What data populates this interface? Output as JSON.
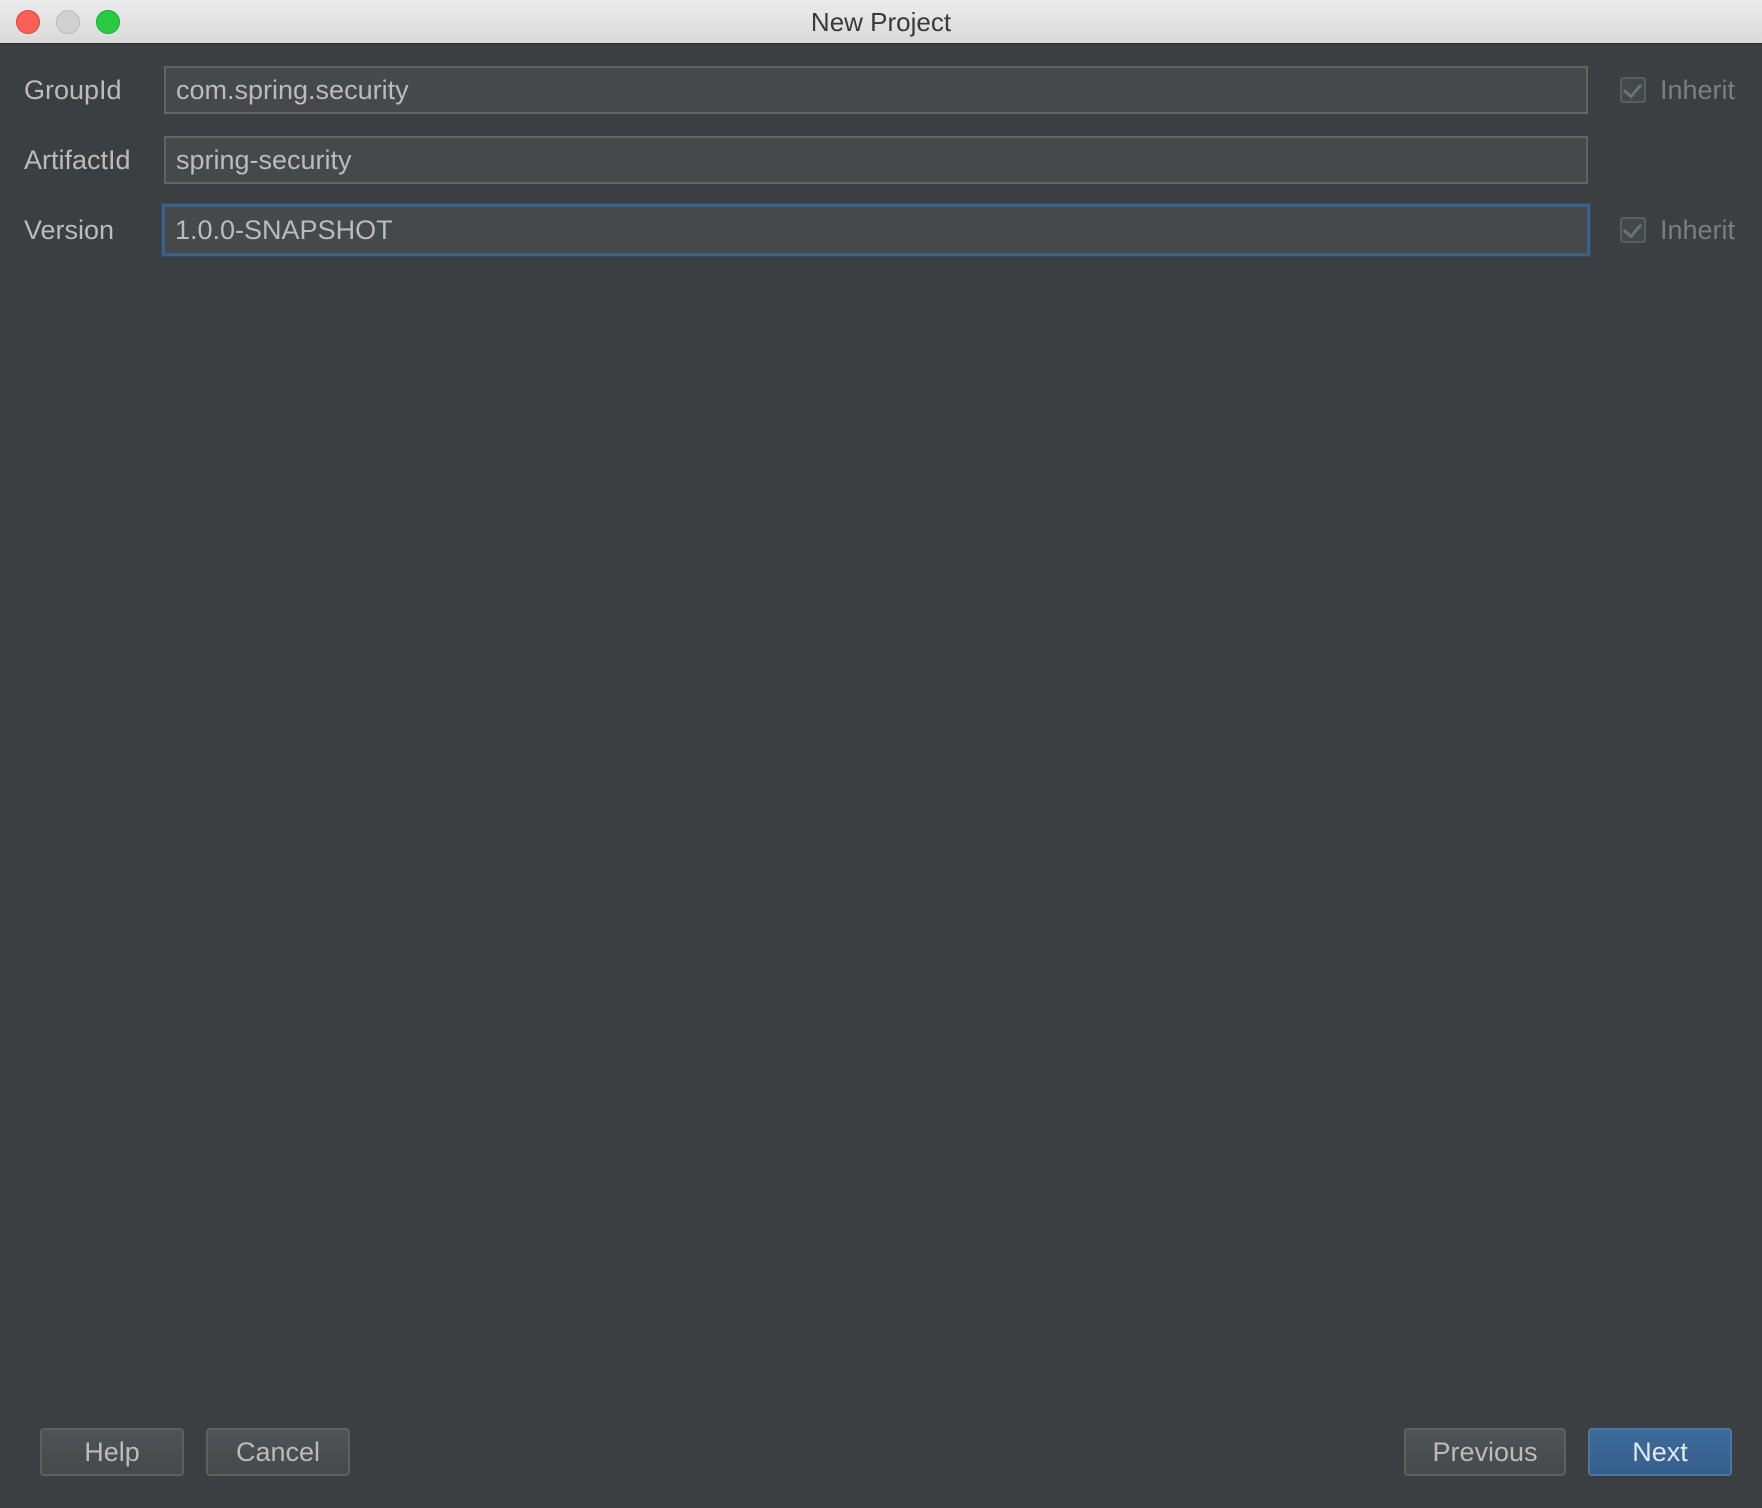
{
  "window": {
    "title": "New Project"
  },
  "form": {
    "group_id": {
      "label": "GroupId",
      "value": "com.spring.security",
      "inherit_label": "Inherit",
      "inherit_checked": true
    },
    "artifact_id": {
      "label": "ArtifactId",
      "value": "spring-security"
    },
    "version": {
      "label": "Version",
      "value": "1.0.0-SNAPSHOT",
      "inherit_label": "Inherit",
      "inherit_checked": true
    }
  },
  "buttons": {
    "help": "Help",
    "cancel": "Cancel",
    "previous": "Previous",
    "next": "Next"
  },
  "colors": {
    "background": "#3c3f41",
    "field_background": "#45494a",
    "focus_border": "#3d6185",
    "primary_button": "#365f8c",
    "text": "#bbbbbb"
  }
}
